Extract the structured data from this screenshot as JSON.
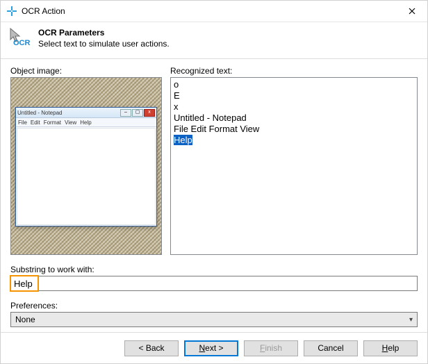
{
  "window": {
    "title": "OCR Action"
  },
  "header": {
    "title": "OCR Parameters",
    "subtitle": "Select text to simulate user actions.",
    "icon_label": "OCR"
  },
  "left_panel": {
    "label": "Object image:",
    "notepad_title": "Untitled - Notepad",
    "notepad_menu": [
      "File",
      "Edit",
      "Format",
      "View",
      "Help"
    ]
  },
  "right_panel": {
    "label": "Recognized text:",
    "lines": [
      "o",
      "E",
      "x",
      "Untitled - Notepad",
      "File Edit Format View"
    ],
    "selected_line": "Help"
  },
  "substring": {
    "label": "Substring to work with:",
    "value": "Help"
  },
  "preferences": {
    "label": "Preferences:",
    "selected": "None"
  },
  "buttons": {
    "back": "< Back",
    "finish": "Finish",
    "cancel": "Cancel"
  }
}
